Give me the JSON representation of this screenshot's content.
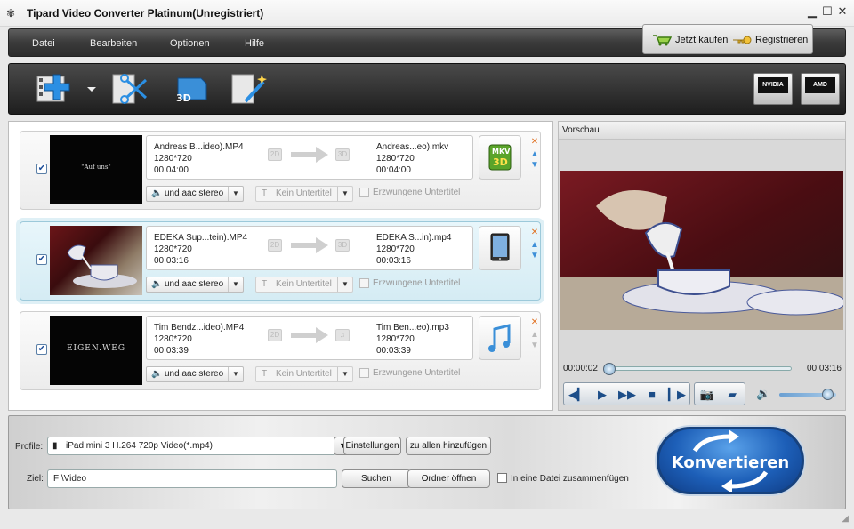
{
  "window": {
    "title": "Tipard Video Converter Platinum(Unregistriert)"
  },
  "menu": {
    "items": [
      "Datei",
      "Bearbeiten",
      "Optionen",
      "Hilfe"
    ],
    "buy_label": "Jetzt kaufen",
    "register_label": "Registrieren"
  },
  "toolbar": {
    "gpu1": "NVIDIA",
    "gpu2": "AMD"
  },
  "files": [
    {
      "source_name": "Andreas B...ideo).MP4",
      "source_res": "1280*720",
      "source_dur": "00:04:00",
      "output_name": "Andreas...eo).mkv",
      "output_res": "1280*720",
      "output_dur": "00:04:00",
      "target_mode": "3D",
      "output_icon": "mkv-3d-icon",
      "audio": "und aac stereo",
      "subtitle": "Kein Untertitel",
      "forced": "Erzwungene Untertitel",
      "thumb_text": "\"Auf uns\""
    },
    {
      "source_name": "EDEKA Sup...tein).MP4",
      "source_res": "1280*720",
      "source_dur": "00:03:16",
      "output_name": "EDEKA S...in).mp4",
      "output_res": "1280*720",
      "output_dur": "00:03:16",
      "target_mode": "3D",
      "output_icon": "ipad-icon",
      "audio": "und aac stereo",
      "subtitle": "Kein Untertitel",
      "forced": "Erzwungene Untertitel",
      "thumb_text": ""
    },
    {
      "source_name": "Tim Bendz...ideo).MP4",
      "source_res": "1280*720",
      "source_dur": "00:03:39",
      "output_name": "Tim Ben...eo).mp3",
      "output_res": "1280*720",
      "output_dur": "00:03:39",
      "target_mode": "♫",
      "output_icon": "mp3-icon",
      "audio": "und aac stereo",
      "subtitle": "Kein Untertitel",
      "forced": "Erzwungene Untertitel",
      "thumb_text": "EIGEN.WEG"
    }
  ],
  "two_d": "2D",
  "preview": {
    "title": "Vorschau",
    "current_time": "00:00:02",
    "total_time": "00:03:16",
    "progress": 0.0,
    "volume": 0.85
  },
  "bottom": {
    "profile_label": "Profile:",
    "profile_value": "iPad mini 3 H.264 720p Video(*.mp4)",
    "settings_label": "Einstellungen",
    "apply_all_label": "zu allen hinzufügen",
    "dest_label": "Ziel:",
    "dest_value": "F:\\Video",
    "browse_label": "Suchen",
    "open_folder_label": "Ordner öffnen",
    "merge_label": "In eine Datei zusammenfügen",
    "convert_label": "Konvertieren"
  }
}
